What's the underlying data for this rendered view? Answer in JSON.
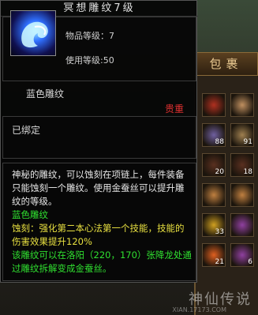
{
  "tooltip": {
    "title": "冥想雕纹7级",
    "item_level_label": "物品等级：7",
    "use_level_label": "使用等级:50",
    "item_name": "蓝色雕纹",
    "rarity": "贵重",
    "binding": "已绑定",
    "description": "神秘的雕纹，可以蚀刻在项链上，每件装备只能蚀刻一个雕纹。使用金蚕丝可以提升雕纹的等级。",
    "type_line": "蓝色雕纹",
    "effect_line": "蚀刻：强化第二本心法第一个技能，技能的伤害效果提升120%",
    "source_line": "该雕纹可以在洛阳（220，170）张降龙处通过雕纹拆解变成金蚕丝。",
    "icon": "blue-spiral-glyph-icon"
  },
  "bag": {
    "title": "包裹",
    "slots": [
      {
        "icon": "red-potion-icon",
        "count": ""
      },
      {
        "icon": "scroll-icon",
        "count": ""
      },
      {
        "icon": "bead-icon",
        "count": "88"
      },
      {
        "icon": "scroll-bundle-icon",
        "count": "91"
      },
      {
        "icon": "coffin-icon",
        "count": "20"
      },
      {
        "icon": "coffin-icon",
        "count": "18"
      },
      {
        "icon": "food-bowl-icon",
        "count": ""
      },
      {
        "icon": "food-bowl-icon",
        "count": ""
      },
      {
        "icon": "gold-ingot-icon",
        "count": "33"
      },
      {
        "icon": "gem-icon",
        "count": ""
      },
      {
        "icon": "fire-orb-icon",
        "count": "21"
      },
      {
        "icon": "gem-icon",
        "count": "6"
      }
    ]
  },
  "watermark": "神仙传说",
  "watermark_sub": "XIAN.17173.COM",
  "colors": {
    "rarity": "#e03030",
    "type": "#30e030",
    "effect": "#e8e040",
    "source": "#30e030"
  }
}
